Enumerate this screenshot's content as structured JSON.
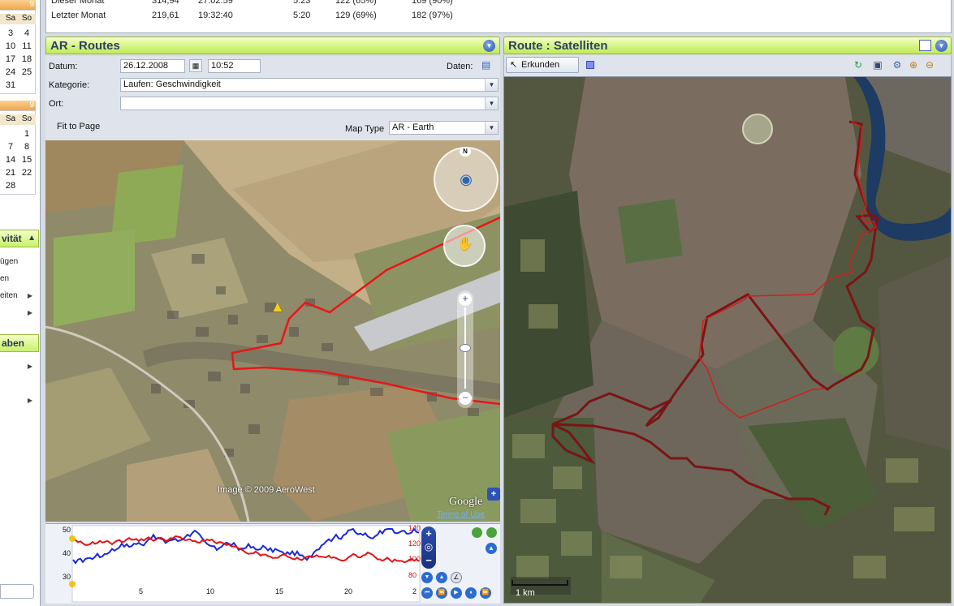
{
  "left_strip": {
    "cal1": {
      "dow": [
        "Sa",
        "So"
      ],
      "rows": [
        [
          "3",
          "4"
        ],
        [
          "10",
          "11"
        ],
        [
          "17",
          "18"
        ],
        [
          "24",
          "25"
        ],
        [
          "31",
          ""
        ]
      ]
    },
    "cal2": {
      "dow": [
        "Sa",
        "So"
      ],
      "rows": [
        [
          "",
          "1"
        ],
        [
          "7",
          "8"
        ],
        [
          "14",
          "15"
        ],
        [
          "21",
          "22"
        ],
        [
          "28",
          ""
        ]
      ]
    },
    "activities_header": "vität",
    "activities_items": [
      "ügen",
      "en",
      "eiten",
      ""
    ],
    "tasks_header": "aben"
  },
  "stats": {
    "rows": [
      {
        "label": "Dieser Monat",
        "distance": "314,94",
        "time": "27:02:59",
        "pace": "5:23",
        "hr1": "122 (65%)",
        "hr2": "169 (90%)"
      },
      {
        "label": "Letzter Monat",
        "distance": "219,61",
        "time": "19:32:40",
        "pace": "5:20",
        "hr1": "129 (69%)",
        "hr2": "182 (97%)"
      }
    ]
  },
  "left_panel": {
    "title": "AR - Routes",
    "datum_label": "Datum:",
    "datum_value": "26.12.2008",
    "time_value": "10:52",
    "daten_label": "Daten:",
    "kategorie_label": "Kategorie:",
    "kategorie_value": "Laufen: Geschwindigkeit",
    "ort_label": "Ort:",
    "ort_value": "",
    "fit_to_page": "Fit to Page",
    "map_type_label": "Map Type",
    "map_type_value": "AR - Earth"
  },
  "left_map": {
    "compass_n": "N",
    "copyright": "Image © 2009 AeroWest",
    "google": "Google",
    "terms": "Terms of Use"
  },
  "profile": {
    "left_ticks": [
      "50",
      "40",
      "30"
    ],
    "right_ticks": [
      "140",
      "120",
      "100",
      "80"
    ],
    "x_ticks": [
      "5",
      "10",
      "15",
      "20",
      "2"
    ],
    "colors": {
      "speed": "#1a2ad6",
      "heart_rate": "#e0141b"
    }
  },
  "right_panel": {
    "title": "Route : Satelliten",
    "explore_button": "Erkunden",
    "scale_label": "1 km"
  }
}
